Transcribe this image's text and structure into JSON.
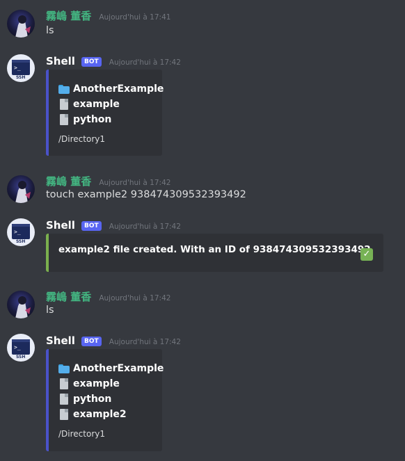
{
  "messages": [
    {
      "author": "霧嶋 董香",
      "time": "Aujourd'hui à 17:41",
      "text": "ls"
    },
    {
      "author": "Shell",
      "bot_tag": "BOT",
      "time": "Aujourd'hui à 17:42",
      "embed": {
        "items": [
          {
            "icon": "folder-icon",
            "name": "AnotherExample"
          },
          {
            "icon": "file-icon",
            "name": "example"
          },
          {
            "icon": "file-icon",
            "name": "python"
          }
        ],
        "path": "/Directory1"
      }
    },
    {
      "author": "霧嶋 董香",
      "time": "Aujourd'hui à 17:42",
      "text": "touch example2 938474309532393492"
    },
    {
      "author": "Shell",
      "bot_tag": "BOT",
      "time": "Aujourd'hui à 17:42",
      "embed": {
        "text": "example2 file created. With an ID of 938474309532393492",
        "icon": "check-mark-icon"
      }
    },
    {
      "author": "霧嶋 董香",
      "time": "Aujourd'hui à 17:42",
      "text": "ls"
    },
    {
      "author": "Shell",
      "bot_tag": "BOT",
      "time": "Aujourd'hui à 17:42",
      "embed": {
        "items": [
          {
            "icon": "folder-icon",
            "name": "AnotherExample"
          },
          {
            "icon": "file-icon",
            "name": "example"
          },
          {
            "icon": "file-icon",
            "name": "python"
          },
          {
            "icon": "file-icon",
            "name": "example2"
          }
        ],
        "path": "/Directory1"
      }
    }
  ],
  "colors": {
    "user_name": "#43b581",
    "bot_tag": "#5865f2",
    "embed_border": "#4a52c9",
    "success_border": "#7bb04e"
  }
}
